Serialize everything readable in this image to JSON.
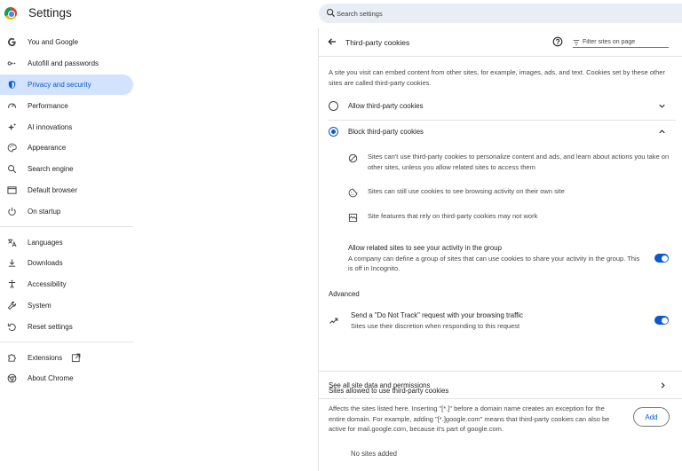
{
  "app": {
    "title": "Settings",
    "logo_icon": "chrome-logo-icon"
  },
  "search": {
    "placeholder": "Search settings"
  },
  "sidebar": {
    "items": [
      {
        "label": "You and Google",
        "icon": "google-g-icon"
      },
      {
        "label": "Autofill and passwords",
        "icon": "key-icon"
      },
      {
        "label": "Privacy and security",
        "icon": "shield-icon",
        "active": true
      },
      {
        "label": "Performance",
        "icon": "speedometer-icon"
      },
      {
        "label": "AI innovations",
        "icon": "sparkle-icon"
      },
      {
        "label": "Appearance",
        "icon": "palette-icon"
      },
      {
        "label": "Search engine",
        "icon": "search-icon"
      },
      {
        "label": "Default browser",
        "icon": "browser-window-icon"
      },
      {
        "label": "On startup",
        "icon": "power-icon"
      },
      {
        "label": "Languages",
        "icon": "translate-icon"
      },
      {
        "label": "Downloads",
        "icon": "download-icon"
      },
      {
        "label": "Accessibility",
        "icon": "accessibility-icon"
      },
      {
        "label": "System",
        "icon": "wrench-icon"
      },
      {
        "label": "Reset settings",
        "icon": "reset-icon"
      },
      {
        "label": "Extensions",
        "icon": "puzzle-icon"
      },
      {
        "label": "About Chrome",
        "icon": "chrome-icon"
      }
    ]
  },
  "page": {
    "title": "Third-party cookies",
    "filter_placeholder": "Filter sites on page",
    "description": "A site you visit can embed content from other sites, for example, images, ads, and text. Cookies set by these other sites are called third-party cookies.",
    "options": [
      {
        "label": "Allow third-party cookies",
        "selected": false
      },
      {
        "label": "Block third-party cookies",
        "selected": true
      }
    ],
    "block_details": [
      "Sites can't use third-party cookies to personalize content and ads, and learn about actions you take on other sites, unless you allow related sites to access them",
      "Sites can still use cookies to see browsing activity on their own site",
      "Site features that rely on third-party cookies may not work"
    ],
    "related_sites": {
      "title": "Allow related sites to see your activity in the group",
      "sub": "A company can define a group of sites that can use cookies to share your activity in the group. This is off in Incognito.",
      "enabled": true
    },
    "advanced_heading": "Advanced",
    "do_not_track": {
      "title": "Send a \"Do Not Track\" request with your browsing traffic",
      "sub": "Sites use their discretion when responding to this request",
      "enabled": true
    },
    "see_all_link": "See all site data and permissions",
    "allowed": {
      "heading": "Sites allowed to use third-party cookies",
      "description": "Affects the sites listed here. Inserting \"[*.]\" before a domain name creates an exception for the entire domain. For example, adding \"[*.]google.com\" means that third-party cookies can also be active for mail.google.com, because it's part of google.com.",
      "add_label": "Add",
      "empty_text": "No sites added"
    }
  },
  "colors": {
    "accent": "#0b57d0",
    "active_bg": "#d3e3fd",
    "search_bg": "#e9eef6"
  }
}
